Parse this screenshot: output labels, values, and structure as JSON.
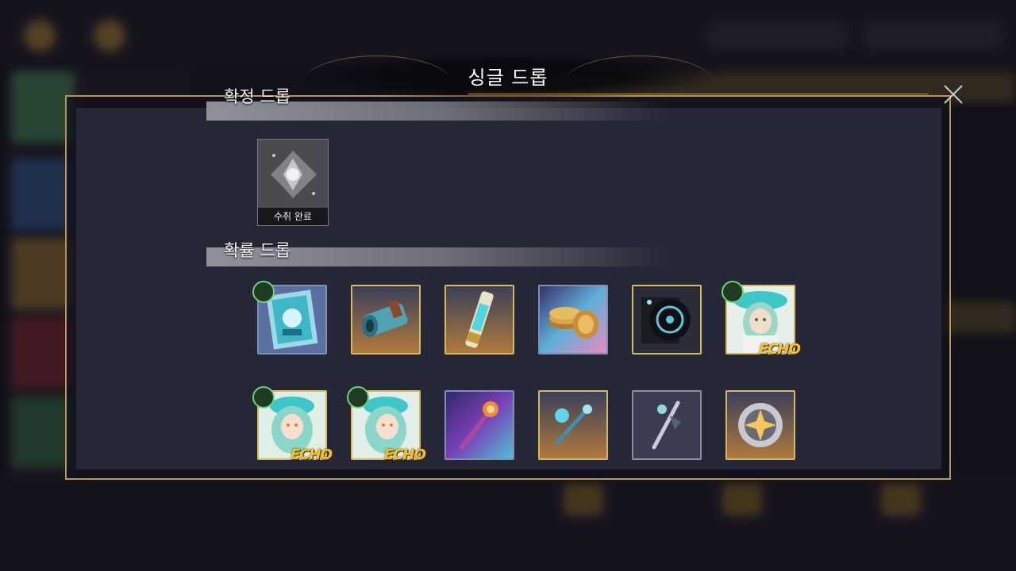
{
  "dialog": {
    "title": "싱글 드롭",
    "sections": [
      {
        "label": "확정 드롭",
        "items": [
          {
            "name": "collected-item",
            "status": "수취 완료"
          }
        ]
      },
      {
        "label": "확률 드롭"
      }
    ]
  },
  "items_row1": [
    {
      "name": "stamp-card-item",
      "frame": "blue",
      "has_char_badge": true
    },
    {
      "name": "pipe-fitting-item",
      "frame": "gold"
    },
    {
      "name": "energy-tube-item",
      "frame": "gold"
    },
    {
      "name": "coin-stack-item",
      "frame": "blue"
    },
    {
      "name": "dark-record-item",
      "frame": "gold"
    },
    {
      "name": "echo-character-item",
      "frame": "gold",
      "has_char_badge": true,
      "badge": "ECHO"
    }
  ],
  "items_row2": [
    {
      "name": "echo-character-item-2",
      "frame": "gold",
      "has_char_badge": true,
      "badge": "ECHO"
    },
    {
      "name": "echo-character-item-3",
      "frame": "gold",
      "has_char_badge": true,
      "badge": "ECHO"
    },
    {
      "name": "fire-staff-item",
      "frame": "blue"
    },
    {
      "name": "ice-wand-item",
      "frame": "gold"
    },
    {
      "name": "silver-staff-item",
      "frame": "gray"
    },
    {
      "name": "star-orb-item",
      "frame": "gold"
    }
  ],
  "colors": {
    "gold": "#d8b85e",
    "frame": "#b5954f",
    "echo": "#f0c431"
  }
}
